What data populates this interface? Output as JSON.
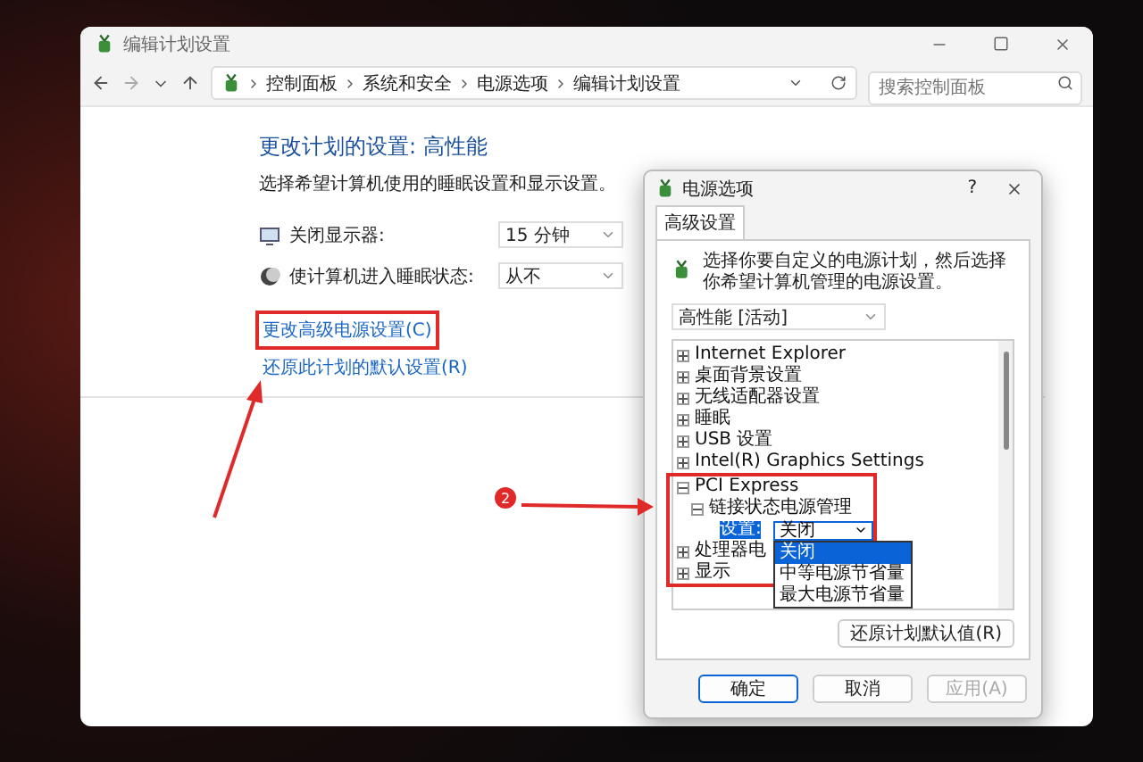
{
  "window": {
    "title": "编辑计划设置"
  },
  "address_bar": {
    "breadcrumbs": [
      "控制面板",
      "系统和安全",
      "电源选项",
      "编辑计划设置"
    ]
  },
  "search": {
    "placeholder": "搜索控制面板"
  },
  "heading": "更改计划的设置: 高性能",
  "description": "选择希望计算机使用的睡眠设置和显示设置。",
  "settings": [
    {
      "label": "关闭显示器:",
      "value": "15 分钟"
    },
    {
      "label": "使计算机进入睡眠状态:",
      "value": "从不"
    }
  ],
  "links": [
    {
      "text": "更改高级电源设置(C)",
      "highlighted": true
    },
    {
      "text": "还原此计划的默认设置(R)",
      "highlighted": false
    }
  ],
  "dialog": {
    "title": "电源选项",
    "help": "?",
    "tabs": [
      {
        "label": "高级设置",
        "selected": true
      }
    ],
    "intro": "选择你要自定义的电源计划，然后选择你希望计算机管理的电源设置。",
    "plan": "高性能 [活动]",
    "tree": [
      {
        "kind": "group",
        "label": "Internet Explorer",
        "expanded": false
      },
      {
        "kind": "group",
        "label": "桌面背景设置",
        "expanded": false
      },
      {
        "kind": "group",
        "label": "无线适配器设置",
        "expanded": false
      },
      {
        "kind": "group",
        "label": "睡眠",
        "expanded": false
      },
      {
        "kind": "group",
        "label": "USB 设置",
        "expanded": false
      },
      {
        "kind": "group",
        "label": "Intel(R) Graphics Settings",
        "expanded": false
      },
      {
        "kind": "group",
        "label": "PCI Express",
        "expanded": true,
        "highlighted": true,
        "children": [
          {
            "kind": "group",
            "label": "链接状态电源管理",
            "expanded": true,
            "children": [
              {
                "kind": "setting",
                "label": "设置:",
                "value": "关闭",
                "open": true,
                "options": [
                  {
                    "label": "关闭",
                    "selected": true
                  },
                  {
                    "label": "中等电源节省量",
                    "selected": false
                  },
                  {
                    "label": "最大电源节省量",
                    "selected": false
                  }
                ]
              }
            ]
          }
        ]
      },
      {
        "kind": "group",
        "label": "处理器电",
        "expanded": false
      },
      {
        "kind": "group",
        "label": "显示",
        "expanded": false
      }
    ],
    "restore_button": "还原计划默认值(R)",
    "buttons": [
      {
        "label": "确定",
        "disabled": false,
        "default": true
      },
      {
        "label": "取消",
        "disabled": false,
        "default": false
      },
      {
        "label": "应用(A)",
        "disabled": true,
        "default": false
      }
    ]
  },
  "annotation_badge": "2"
}
